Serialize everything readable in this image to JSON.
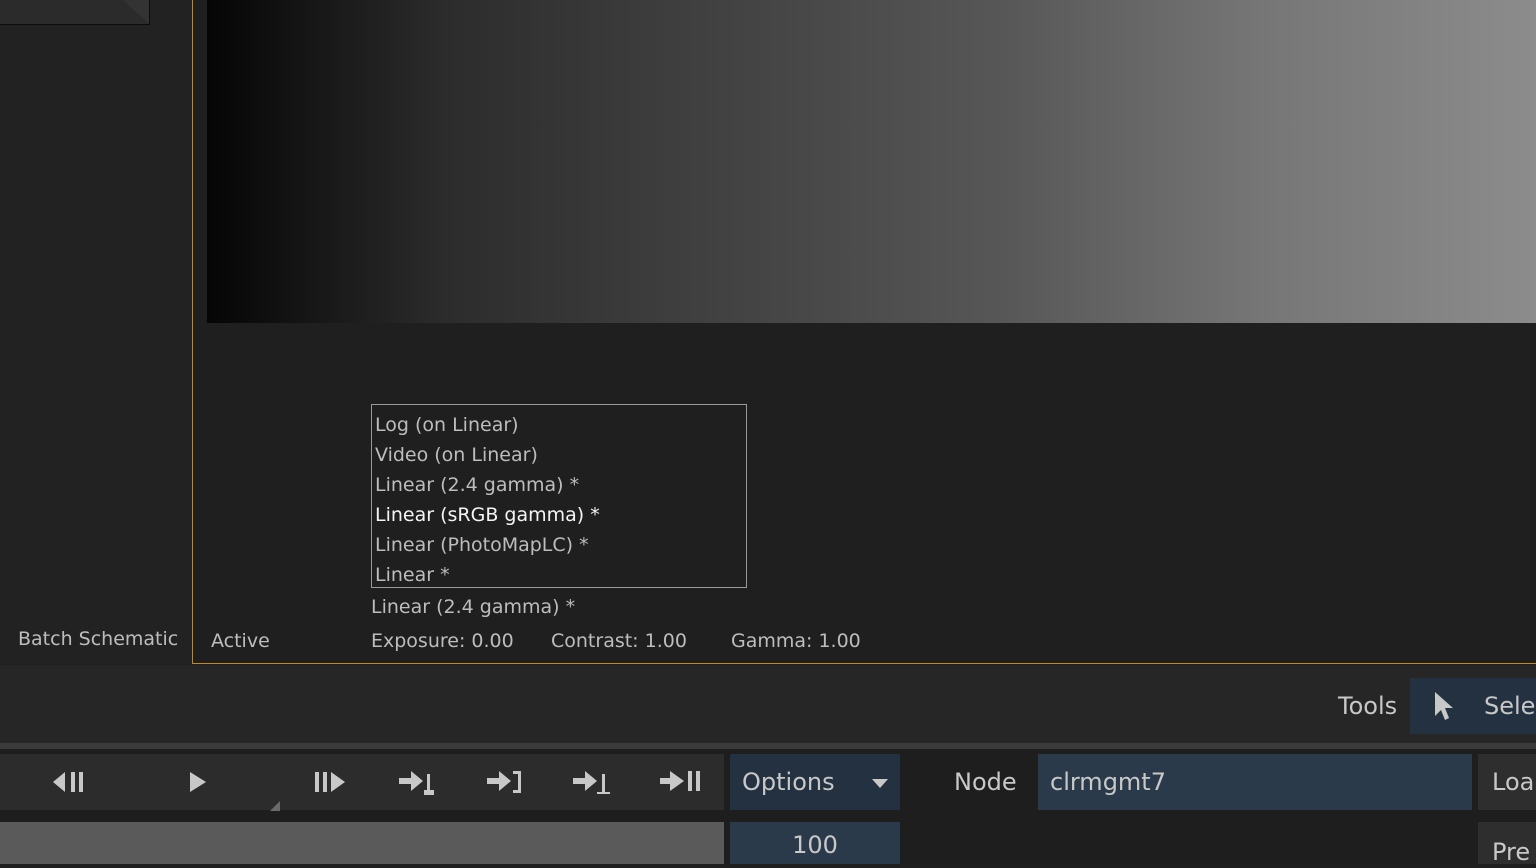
{
  "left_panel": {
    "label": "Batch Schematic"
  },
  "viewer": {
    "lut_list": [
      {
        "label": "Log (on Linear)",
        "selected": false
      },
      {
        "label": "Video (on Linear)",
        "selected": false
      },
      {
        "label": "Linear (2.4 gamma) *",
        "selected": false
      },
      {
        "label": "Linear (sRGB gamma) *",
        "selected": true
      },
      {
        "label": "Linear (PhotoMapLC) *",
        "selected": false
      },
      {
        "label": "Linear *",
        "selected": false
      }
    ],
    "current_lut": "Linear (2.4 gamma) *",
    "status": "Active",
    "exposure": "Exposure: 0.00",
    "contrast": "Contrast: 1.00",
    "gamma": "Gamma: 1.00"
  },
  "tools": {
    "label": "Tools",
    "select_label": "Selec",
    "select_icon": "pointer-arrow-icon"
  },
  "transport": {
    "icons": [
      "step-back-icon",
      "play-icon",
      "step-forward-icon",
      "go-to-in-icon",
      "go-to-out-icon",
      "go-to-mark-icon",
      "go-to-end-icon"
    ]
  },
  "options": {
    "label": "Options"
  },
  "node": {
    "label": "Node",
    "value": "clrmgmt7"
  },
  "load_button": {
    "label": "Loa"
  },
  "frame": {
    "value": "100"
  },
  "preview_button": {
    "label": "Pre"
  },
  "colors": {
    "accent_border": "#c08a1e",
    "field_blue": "#2b3a4a",
    "button_blue": "#243140"
  }
}
